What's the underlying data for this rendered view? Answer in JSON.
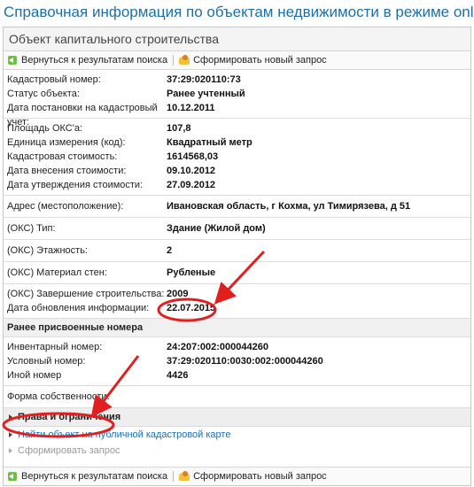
{
  "headline": "Справочная информация по объектам недвижимости в режиме online",
  "window_title": "Объект капитального строительства",
  "toolbar": {
    "back_label": "Вернуться к результатам поиска",
    "new_label": "Сформировать новый запрос"
  },
  "group1": [
    {
      "label": "Кадастровый номер:",
      "value": "37:29:020110:73"
    },
    {
      "label": "Статус объекта:",
      "value": "Ранее учтенный"
    },
    {
      "label": "Дата постановки на кадастровый учет:",
      "value": "10.12.2011"
    }
  ],
  "group2": [
    {
      "label": "Площадь ОКС'a:",
      "value": "107,8"
    },
    {
      "label": "Единица измерения (код):",
      "value": "Квадратный метр"
    },
    {
      "label": "Кадастровая стоимость:",
      "value": "1614568,03"
    },
    {
      "label": "Дата внесения стоимости:",
      "value": "09.10.2012"
    },
    {
      "label": "Дата утверждения стоимости:",
      "value": "27.09.2012"
    }
  ],
  "address": {
    "label": "Адрес (местоположение):",
    "value": "Ивановская область, г Кохма, ул Тимирязева, д 51"
  },
  "type": {
    "label": "(ОКС) Тип:",
    "value": "Здание (Жилой дом)"
  },
  "floors": {
    "label": "(ОКС) Этажность:",
    "value": "2"
  },
  "walls": {
    "label": "(ОКС) Материал стен:",
    "value": "Рубленые"
  },
  "group3": [
    {
      "label": "(ОКС) Завершение строительства:",
      "value": "2009"
    },
    {
      "label": "Дата обновления информации:",
      "value": "22.07.2015"
    }
  ],
  "prev_numbers": {
    "header": "Ранее присвоенные номера",
    "rows": [
      {
        "label": "Инвентарный номер:",
        "value": "24:207:002:000044260"
      },
      {
        "label": "Условный номер:",
        "value": "37:29:020110:0030:002:000044260"
      },
      {
        "label": "Иной номер",
        "value": "4426"
      }
    ]
  },
  "ownership": {
    "label": "Форма собственности:",
    "value": ""
  },
  "rights_label": "Права и ограничения",
  "map_link": "Найти объект на публичной кадастровой карте",
  "request_label": "Сформировать запрос",
  "colors": {
    "headline": "#1d6fa8",
    "link": "#1a6eb5",
    "annotation": "#e02020"
  }
}
